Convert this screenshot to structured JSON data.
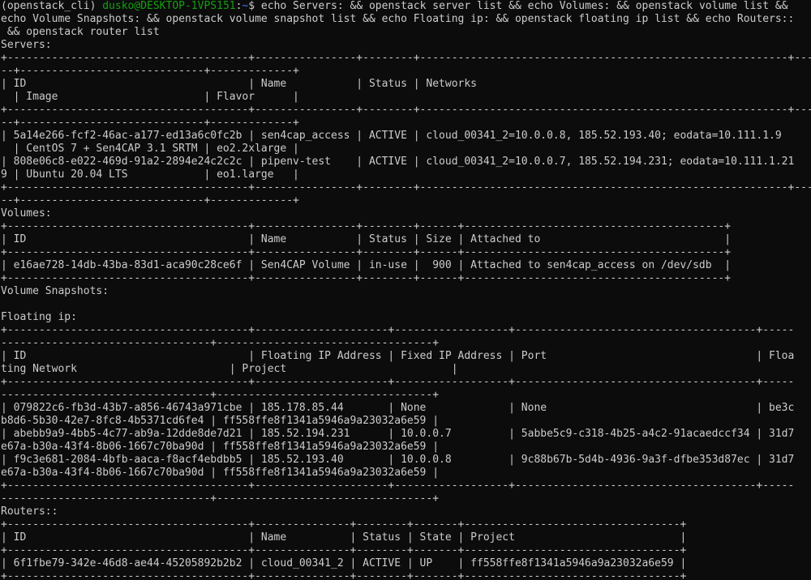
{
  "colors": {
    "background": "#0c0c0c",
    "text": "#cccccc",
    "prompt_user": "#13a10e",
    "prompt_path": "#3b78ff"
  },
  "prompt": {
    "env": "(openstack_cli) ",
    "user_host": "dusko@DESKTOP-1VPS151",
    "colon": ":",
    "path": "~",
    "symbol": "$ ",
    "command_line_1": "echo Servers: && openstack server list && echo Volumes: && openstack volume list &&",
    "command_line_2": "echo Volume Snapshots: && openstack volume snapshot list && echo Floating ip: && openstack floating ip list && echo Routers::",
    "command_line_3": " && openstack router list"
  },
  "output_lines": [
    "Servers:",
    "+--------------------------------------+----------------+--------+----------------------------------------------------------+-----",
    "--+-----------------------------+-------------+",
    "| ID                                   | Name           | Status | Networks",
    "  | Image                       | Flavor      |",
    "+--------------------------------------+----------------+--------+----------------------------------------------------------+-----",
    "--+-----------------------------+-------------+",
    "| 5a14e266-fcf2-46ac-a177-ed13a6c0fc2b | sen4cap_access | ACTIVE | cloud_00341_2=10.0.0.8, 185.52.193.40; eodata=10.111.1.9",
    "  | CentOS 7 + Sen4CAP 3.1 SRTM | eo2.2xlarge |",
    "| 808e06c8-e022-469d-91a2-2894e24c2c2c | pipenv-test    | ACTIVE | cloud_00341_2=10.0.0.7, 185.52.194.231; eodata=10.111.1.21",
    "9 | Ubuntu 20.04 LTS            | eo1.large   |",
    "+--------------------------------------+----------------+--------+----------------------------------------------------------+-----",
    "--+-----------------------------+-------------+",
    "Volumes:",
    "+--------------------------------------+----------------+--------+------+-----------------------------------------+",
    "| ID                                   | Name           | Status | Size | Attached to                             |",
    "+--------------------------------------+----------------+--------+------+-----------------------------------------+",
    "| e16ae728-14db-43ba-83d1-aca90c28ce6f | Sen4CAP Volume | in-use |  900 | Attached to sen4cap_access on /dev/sdb  |",
    "+--------------------------------------+----------------+--------+------+-----------------------------------------+",
    "Volume Snapshots:",
    "",
    "Floating ip:",
    "+--------------------------------------+---------------------+------------------+--------------------------------------+-----",
    "---------------------------------+----------------------------------+",
    "| ID                                   | Floating IP Address | Fixed IP Address | Port                                 | Floa",
    "ting Network                        | Project                          |",
    "+--------------------------------------+---------------------+------------------+--------------------------------------+-----",
    "---------------------------------+----------------------------------+",
    "| 079822c6-fb3d-43b7-a856-46743a971cbe | 185.178.85.44       | None             | None                                 | be3c",
    "b8d6-5b30-42e7-8fc8-4b5371cd6fe4 | ff558ffe8f1341a5946a9a23032a6e59 |",
    "| abebb9a9-4bb5-4c77-ab9a-12dde8de7d21 | 185.52.194.231      | 10.0.0.7         | 5abbe5c9-c318-4b25-a4c2-91acaedccf34 | 31d7",
    "e67a-b30a-43f4-8b06-1667c70ba90d | ff558ffe8f1341a5946a9a23032a6e59 |",
    "| f9c3e681-2084-4bfb-aaca-f8acf4ebdbb5 | 185.52.193.40       | 10.0.0.8         | 9c88b67b-5d4b-4936-9a3f-dfbe353d87ec | 31d7",
    "e67a-b30a-43f4-8b06-1667c70ba90d | ff558ffe8f1341a5946a9a23032a6e59 |",
    "+--------------------------------------+---------------------+------------------+--------------------------------------+-----",
    "---------------------------------+----------------------------------+",
    "Routers::",
    "+--------------------------------------+---------------+--------+-------+----------------------------------+",
    "| ID                                   | Name          | Status | State | Project                          |",
    "+--------------------------------------+---------------+--------+-------+----------------------------------+",
    "| 6f1fbe79-342e-46d8-ae44-45205892b2b2 | cloud_00341_2 | ACTIVE | UP    | ff558ffe8f1341a5946a9a23032a6e59 |",
    "+--------------------------------------+---------------+--------+-------+----------------------------------+"
  ]
}
